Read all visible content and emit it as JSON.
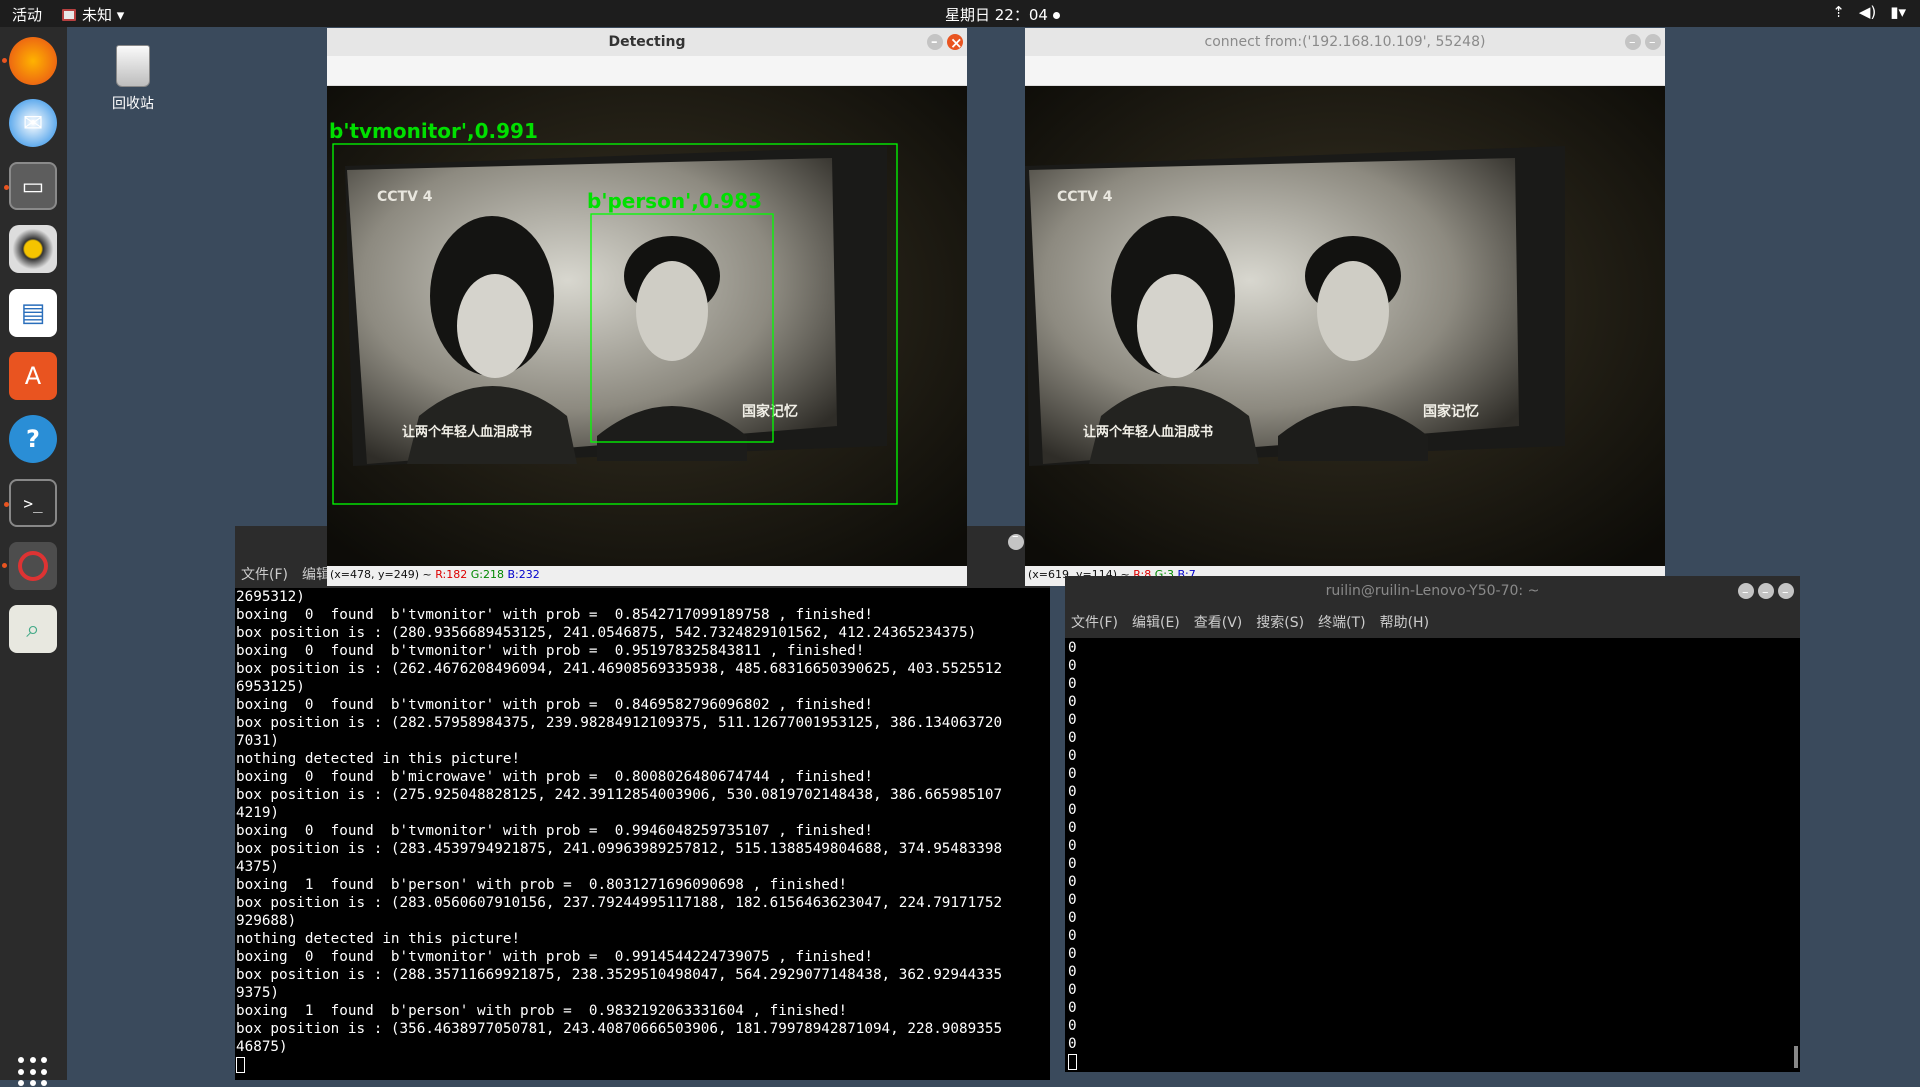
{
  "topbar": {
    "activities": "活动",
    "app_name": "未知 ▾",
    "clock": "星期日 22：04"
  },
  "desktop": {
    "trash_label": "回收站"
  },
  "dock": {
    "items": [
      "firefox-icon",
      "thunderbird-icon",
      "files-icon",
      "rhythmbox-icon",
      "writer-icon",
      "software-icon",
      "help-icon",
      "terminal-icon",
      "stop-app-icon",
      "image-viewer-icon",
      "show-apps-icon"
    ]
  },
  "detect_window": {
    "title": "Detecting",
    "status_prefix": "(x=478, y=249) ~",
    "r": "R:182",
    "g": "G:218",
    "b": "B:232",
    "labels": {
      "tv": "b'tvmonitor',0.991",
      "person": "b'person',0.983"
    },
    "tv_text": {
      "logo": "CCTV 4",
      "sub": "让两个年轻人血泪成书",
      "brand": "国家记忆"
    }
  },
  "cam_window": {
    "title": "connect from:('192.168.10.109', 55248)",
    "status_prefix": "(x=619, y=114) ~",
    "r": "R:8",
    "g": "G:3",
    "b": "B:7"
  },
  "term_left": {
    "menu": [
      "文件(F)",
      "编辑"
    ],
    "lines": [
      "2695312)",
      "boxing  0  found  b'tvmonitor' with prob =  0.8542717099189758 , finished!",
      "box position is : (280.9356689453125, 241.0546875, 542.7324829101562, 412.24365234375)",
      "boxing  0  found  b'tvmonitor' with prob =  0.951978325843811 , finished!",
      "box position is : (262.4676208496094, 241.46908569335938, 485.68316650390625, 403.5525512",
      "6953125)",
      "boxing  0  found  b'tvmonitor' with prob =  0.8469582796096802 , finished!",
      "box position is : (282.57958984375, 239.98284912109375, 511.12677001953125, 386.134063720",
      "7031)",
      "nothing detected in this picture!",
      "boxing  0  found  b'microwave' with prob =  0.8008026480674744 , finished!",
      "box position is : (275.925048828125, 242.39112854003906, 530.0819702148438, 386.665985107",
      "4219)",
      "boxing  0  found  b'tvmonitor' with prob =  0.9946048259735107 , finished!",
      "box position is : (283.4539794921875, 241.09963989257812, 515.1388549804688, 374.95483398",
      "4375)",
      "boxing  1  found  b'person' with prob =  0.8031271696090698 , finished!",
      "box position is : (283.0560607910156, 237.79244995117188, 182.6156463623047, 224.79171752",
      "929688)",
      "nothing detected in this picture!",
      "boxing  0  found  b'tvmonitor' with prob =  0.9914544224739075 , finished!",
      "box position is : (288.35711669921875, 238.3529510498047, 564.2929077148438, 362.92944335",
      "9375)",
      "boxing  1  found  b'person' with prob =  0.9832192063331604 , finished!",
      "box position is : (356.4638977050781, 243.40870666503906, 181.79978942871094, 228.9089355",
      "46875)"
    ]
  },
  "term_right": {
    "title": "ruilin@ruilin-Lenovo-Y50-70: ~",
    "menu": [
      "文件(F)",
      "编辑(E)",
      "查看(V)",
      "搜索(S)",
      "终端(T)",
      "帮助(H)"
    ],
    "lines": [
      "0",
      "0",
      "0",
      "0",
      "0",
      "0",
      "0",
      "0",
      "0",
      "0",
      "0",
      "0",
      "0",
      "0",
      "0",
      "0",
      "0",
      "0",
      "0",
      "0",
      "0",
      "0",
      "0"
    ]
  }
}
